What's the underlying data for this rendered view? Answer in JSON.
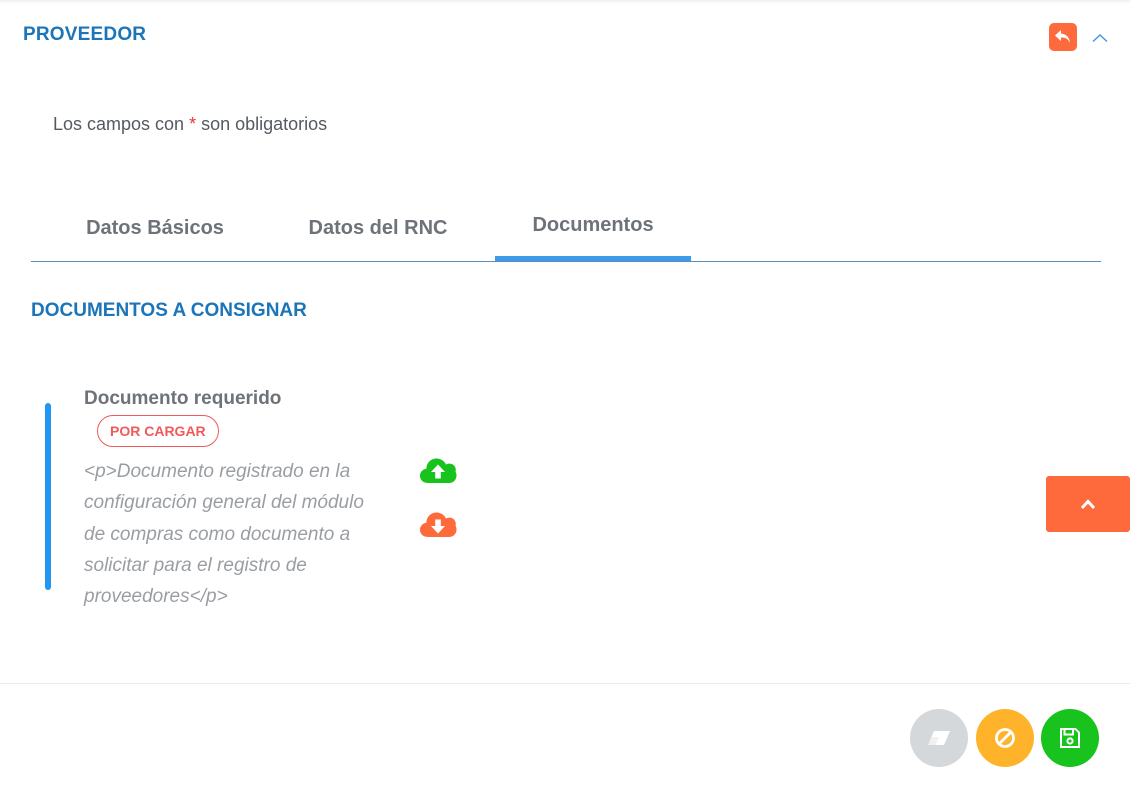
{
  "header": {
    "title": "PROVEEDOR"
  },
  "form": {
    "required_prefix": "Los campos con ",
    "required_star": "*",
    "required_suffix": " son obligatorios"
  },
  "tabs": [
    {
      "label": "Datos Básicos",
      "active": false
    },
    {
      "label": "Datos del RNC",
      "active": false
    },
    {
      "label": "Documentos",
      "active": true
    }
  ],
  "documents": {
    "section_title": "DOCUMENTOS A CONSIGNAR",
    "items": [
      {
        "name": "Documento requerido",
        "status": "POR CARGAR",
        "description": "<p>Documento registrado en la configuración general del módulo de compras como documento a solicitar para el registro de proveedores</p>"
      }
    ]
  },
  "icons": {
    "back": "reply-icon",
    "collapse": "chevron-up-icon",
    "upload": "cloud-upload-icon",
    "download": "cloud-download-icon",
    "scroll_top": "chevron-up-icon",
    "clear": "eraser-icon",
    "cancel": "ban-icon",
    "save": "floppy-disk-icon"
  },
  "colors": {
    "title_blue": "#1c75b9",
    "accent_orange": "#ff6a3d",
    "tab_indicator": "#3d9be9",
    "status_red": "#f05a5a",
    "upload_green": "#19c31e",
    "cancel_yellow": "#ffb32b",
    "clear_gray": "#d5d8db"
  }
}
